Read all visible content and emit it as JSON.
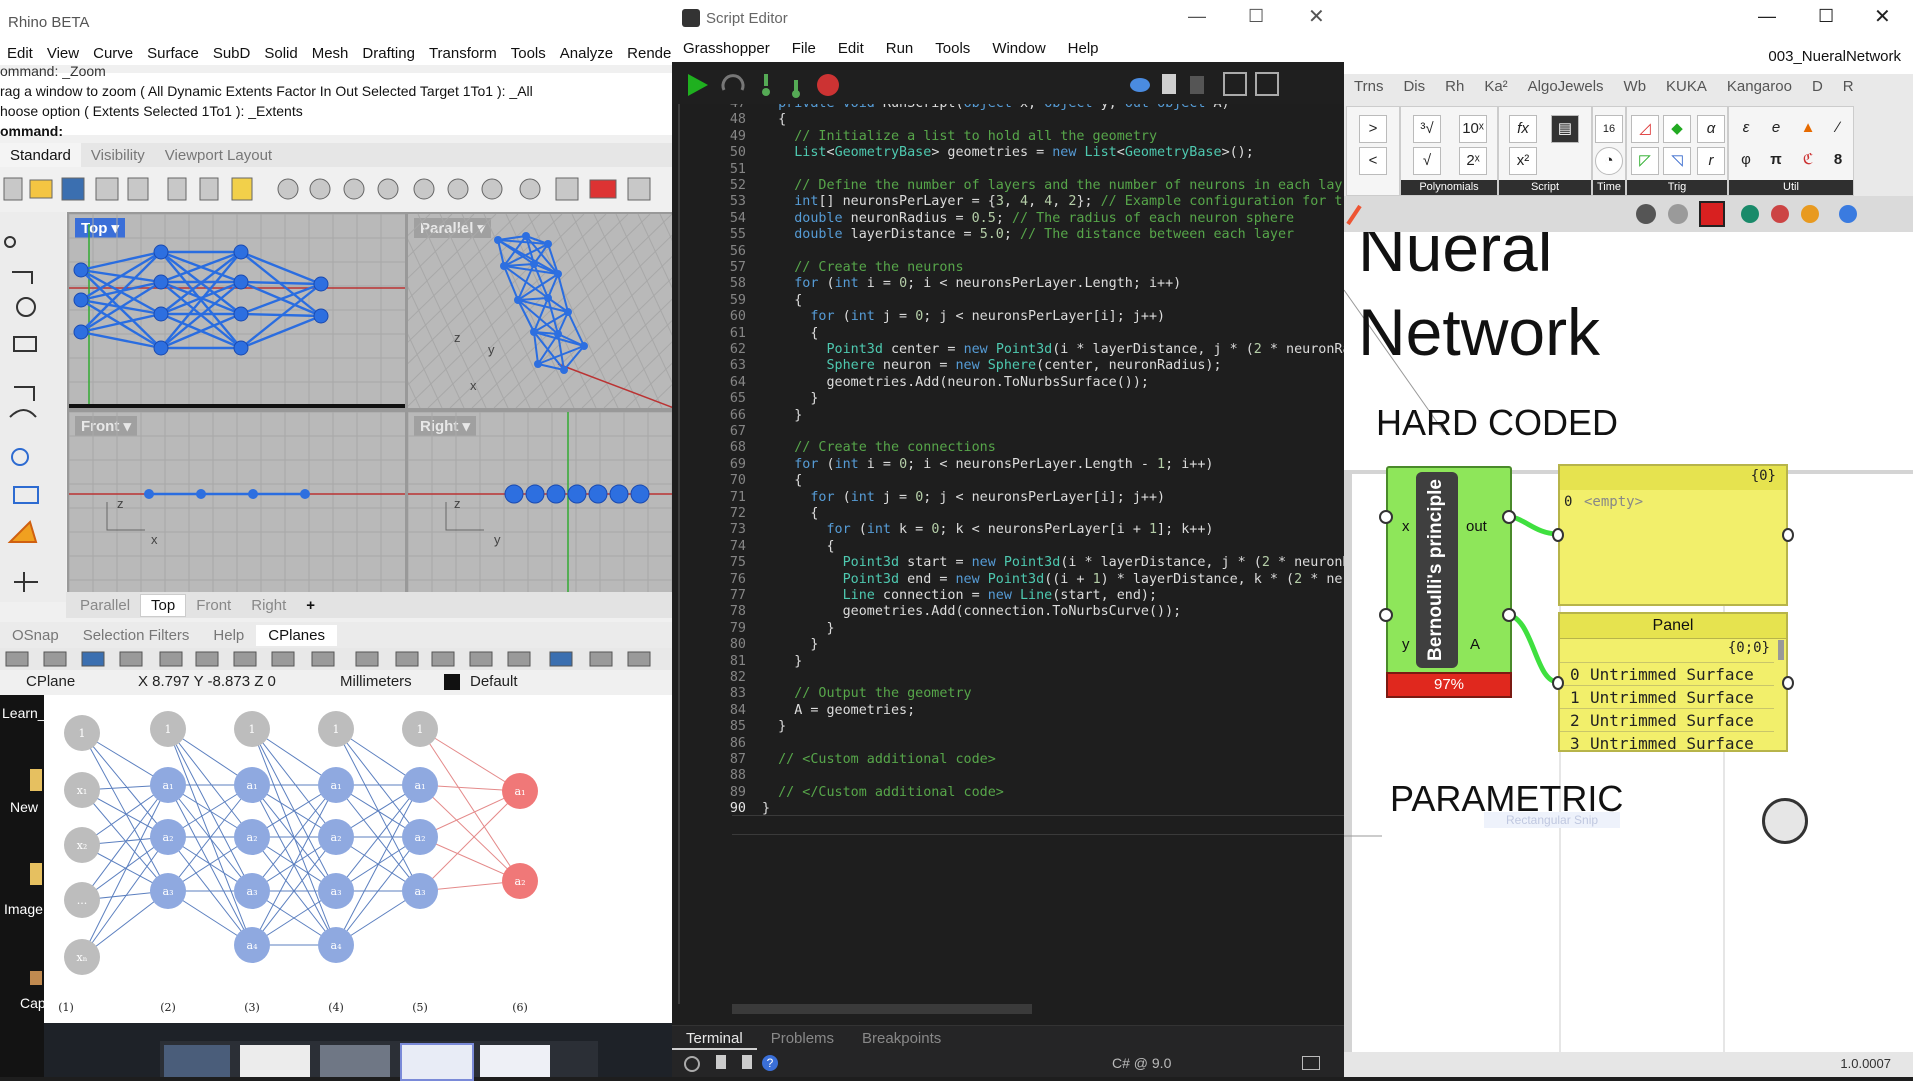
{
  "rhino": {
    "title": "Rhino BETA",
    "menu": [
      "Edit",
      "View",
      "Curve",
      "Surface",
      "SubD",
      "Solid",
      "Mesh",
      "Drafting",
      "Transform",
      "Tools",
      "Analyze",
      "Rende"
    ],
    "command_lines": [
      "ommand: _Zoom",
      "rag a window to zoom ( All  Dynamic  Extents  Factor  In  Out  Selected  Target  1To1 ): _All",
      "hoose option ( Extents  Selected  1To1 ): _Extents"
    ],
    "command_prompt": "ommand:",
    "toolbar_tabs": [
      "Standard",
      "Visibility",
      "Viewport Layout"
    ],
    "viewports": {
      "top": "Top",
      "parallel": "Parallel",
      "front": "Front",
      "right": "Right"
    },
    "axis_labels": {
      "x": "x",
      "y": "y",
      "z": "z"
    },
    "viewport_tabs": [
      "Parallel",
      "Top",
      "Front",
      "Right",
      "+"
    ],
    "viewport_tabs_active": "Top",
    "panel_tabs": [
      "OSnap",
      "Selection Filters",
      "Help",
      "CPlanes"
    ],
    "panel_tabs_active": "CPlanes",
    "status": {
      "cplane": "CPlane",
      "coords": "X 8.797 Y -8.873 Z 0",
      "units": "Millimeters",
      "layer": "Default"
    }
  },
  "desktop_icons": [
    "Learn_",
    "New",
    "Image",
    "Cap"
  ],
  "nn_diagram": {
    "layer_labels": [
      "(1)",
      "(2)",
      "(3)",
      "(4)",
      "(5)",
      "(6)"
    ],
    "bias_label": "1",
    "input_labels": [
      "1",
      "x₁",
      "x₂",
      "...",
      "xₙ"
    ],
    "hidden_labels": [
      "a₁",
      "a₂",
      "a₃",
      "a₄"
    ],
    "output_labels": [
      "a₁",
      "a₂"
    ],
    "colors": {
      "bias": "#bdbdbd",
      "hidden": "#8fa9e0",
      "output": "#f07878",
      "edge_blue": "#5b7fbf",
      "edge_red": "#e48a8a"
    }
  },
  "script_editor": {
    "title": "Script Editor",
    "menu": [
      "Grasshopper",
      "File",
      "Edit",
      "Run",
      "Tools",
      "Window",
      "Help"
    ],
    "current_line": "90",
    "bottom_tabs": [
      "Terminal",
      "Problems",
      "Breakpoints"
    ],
    "bottom_tabs_active": "Terminal",
    "language": "C# @ 9.0",
    "code": [
      [
        "47",
        "  private void RunScript(object x, object y, out object A)"
      ],
      [
        "48",
        "  {"
      ],
      [
        "49",
        "    // Initialize a list to hold all the geometry"
      ],
      [
        "50",
        "    List<GeometryBase> geometries = new List<GeometryBase>();"
      ],
      [
        "51",
        ""
      ],
      [
        "52",
        "    // Define the number of layers and the number of neurons in each lay"
      ],
      [
        "53",
        "    int[] neuronsPerLayer = {3, 4, 4, 2}; // Example configuration for t"
      ],
      [
        "54",
        "    double neuronRadius = 0.5; // The radius of each neuron sphere"
      ],
      [
        "55",
        "    double layerDistance = 5.0; // The distance between each layer"
      ],
      [
        "56",
        ""
      ],
      [
        "57",
        "    // Create the neurons"
      ],
      [
        "58",
        "    for (int i = 0; i < neuronsPerLayer.Length; i++)"
      ],
      [
        "59",
        "    {"
      ],
      [
        "60",
        "      for (int j = 0; j < neuronsPerLayer[i]; j++)"
      ],
      [
        "61",
        "      {"
      ],
      [
        "62",
        "        Point3d center = new Point3d(i * layerDistance, j * (2 * neuronRa"
      ],
      [
        "63",
        "        Sphere neuron = new Sphere(center, neuronRadius);"
      ],
      [
        "64",
        "        geometries.Add(neuron.ToNurbsSurface());"
      ],
      [
        "65",
        "      }"
      ],
      [
        "66",
        "    }"
      ],
      [
        "67",
        ""
      ],
      [
        "68",
        "    // Create the connections"
      ],
      [
        "69",
        "    for (int i = 0; i < neuronsPerLayer.Length - 1; i++)"
      ],
      [
        "70",
        "    {"
      ],
      [
        "71",
        "      for (int j = 0; j < neuronsPerLayer[i]; j++)"
      ],
      [
        "72",
        "      {"
      ],
      [
        "73",
        "        for (int k = 0; k < neuronsPerLayer[i + 1]; k++)"
      ],
      [
        "74",
        "        {"
      ],
      [
        "75",
        "          Point3d start = new Point3d(i * layerDistance, j * (2 * neuronR"
      ],
      [
        "76",
        "          Point3d end = new Point3d((i + 1) * layerDistance, k * (2 * ne"
      ],
      [
        "77",
        "          Line connection = new Line(start, end);"
      ],
      [
        "78",
        "          geometries.Add(connection.ToNurbsCurve());"
      ],
      [
        "79",
        "        }"
      ],
      [
        "80",
        "      }"
      ],
      [
        "81",
        "    }"
      ],
      [
        "82",
        ""
      ],
      [
        "83",
        "    // Output the geometry"
      ],
      [
        "84",
        "    A = geometries;"
      ],
      [
        "85",
        "  }"
      ],
      [
        "86",
        ""
      ],
      [
        "87",
        "  // <Custom additional code>"
      ],
      [
        "88",
        ""
      ],
      [
        "89",
        "  // </Custom additional code>"
      ],
      [
        "90",
        "}"
      ]
    ]
  },
  "grasshopper": {
    "doc_name": "003_NueralNetwork",
    "tabs": [
      "Trns",
      "Dis",
      "Rh",
      "Ka²",
      "AlgoJewels",
      "Wb",
      "KUKA",
      "Kangaroo",
      "D",
      "R"
    ],
    "ribbon_groups": [
      "Polynomials",
      "Script",
      "Time",
      "Trig",
      "Util"
    ],
    "ribbon_glyphs": [
      ">",
      "<",
      "√",
      "x²",
      "ε",
      "e",
      "φ",
      "π",
      "α",
      "8"
    ],
    "canvas": {
      "title_line1": "Nueral",
      "title_line2": "Network",
      "hard_coded": "HARD CODED",
      "parametric": "PARAMETRIC",
      "component_name": "Bernoulli's principle",
      "input_x": "x",
      "input_y": "y",
      "output_out": "out",
      "output_a": "A",
      "progress": "97%",
      "panel1_path": "{0}",
      "panel1_index": "0",
      "panel1_value": "<empty>",
      "panel2_title": "Panel",
      "panel2_path": "{0;0}",
      "panel2_rows": [
        {
          "i": "0",
          "v": "Untrimmed Surface"
        },
        {
          "i": "1",
          "v": "Untrimmed Surface"
        },
        {
          "i": "2",
          "v": "Untrimmed Surface"
        },
        {
          "i": "3",
          "v": "Untrimmed Surface"
        }
      ],
      "snip_hint": "Rectangular Snip"
    },
    "version": "1.0.0007"
  }
}
